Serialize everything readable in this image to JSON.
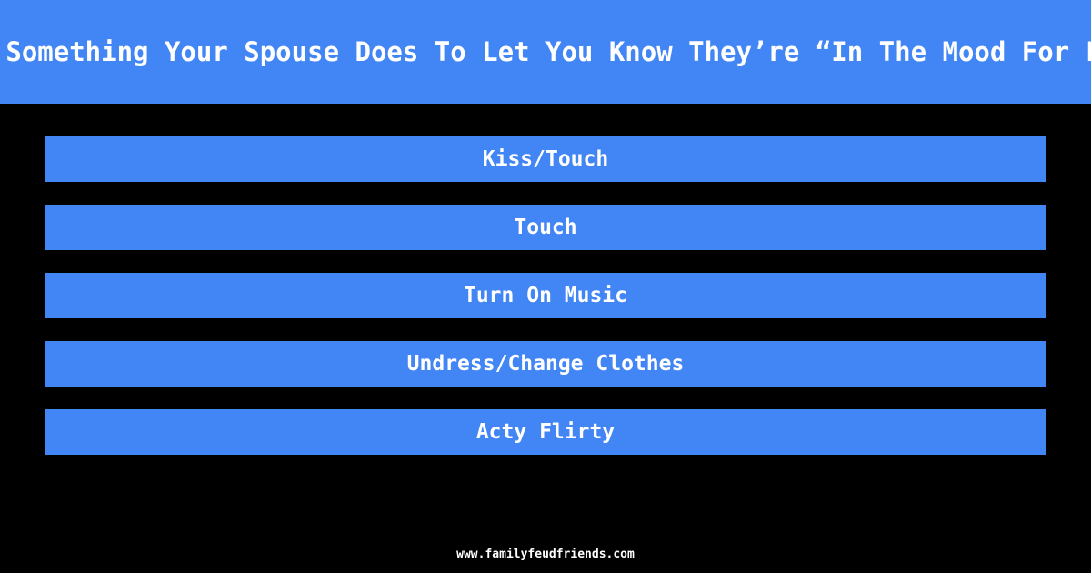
{
  "header": {
    "title": "Name Something Your Spouse Does To Let You Know They’re “In The Mood For Love”",
    "background_color": "#4285f4",
    "text_color": "#ffffff"
  },
  "board": {
    "background_color": "#000000",
    "bar_color": "#4285f4",
    "bar_text_color": "#ffffff",
    "answers": [
      {
        "rank": 1,
        "text": "Kiss/Touch"
      },
      {
        "rank": 2,
        "text": "Touch"
      },
      {
        "rank": 3,
        "text": "Turn On Music"
      },
      {
        "rank": 4,
        "text": "Undress/Change Clothes"
      },
      {
        "rank": 5,
        "text": "Acty Flirty"
      }
    ]
  },
  "footer": {
    "site": "www.familyfeudfriends.com"
  }
}
